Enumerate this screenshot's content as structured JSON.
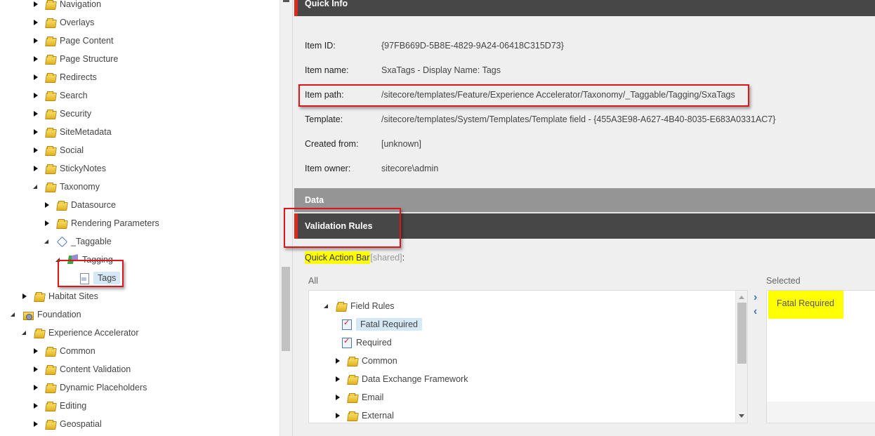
{
  "tree": {
    "nodes": [
      {
        "label": "Navigation",
        "icon": "folder-icon",
        "state": "collapsed"
      },
      {
        "label": "Overlays",
        "icon": "folder-icon",
        "state": "collapsed"
      },
      {
        "label": "Page Content",
        "icon": "folder-icon",
        "state": "collapsed"
      },
      {
        "label": "Page Structure",
        "icon": "folder-icon",
        "state": "collapsed"
      },
      {
        "label": "Redirects",
        "icon": "folder-icon",
        "state": "collapsed"
      },
      {
        "label": "Search",
        "icon": "folder-icon",
        "state": "collapsed"
      },
      {
        "label": "Security",
        "icon": "folder-icon",
        "state": "collapsed"
      },
      {
        "label": "SiteMetadata",
        "icon": "folder-icon",
        "state": "collapsed"
      },
      {
        "label": "Social",
        "icon": "folder-icon",
        "state": "collapsed"
      },
      {
        "label": "StickyNotes",
        "icon": "folder-icon",
        "state": "collapsed"
      },
      {
        "label": "Taxonomy",
        "icon": "folder-icon",
        "state": "expanded"
      },
      {
        "label": "Datasource",
        "icon": "folder-icon",
        "state": "collapsed"
      },
      {
        "label": "Rendering Parameters",
        "icon": "folder-icon",
        "state": "collapsed"
      },
      {
        "label": "_Taggable",
        "icon": "tag-icon",
        "state": "expanded"
      },
      {
        "label": "Tagging",
        "icon": "template-section-icon",
        "state": "expanded"
      },
      {
        "label": "Tags",
        "icon": "template-field-icon",
        "state": "none",
        "selected": true
      },
      {
        "label": "Habitat Sites",
        "icon": "folder-icon",
        "state": "collapsed"
      },
      {
        "label": "Foundation",
        "icon": "settings-folder-icon",
        "state": "expanded"
      },
      {
        "label": "Experience Accelerator",
        "icon": "folder-icon",
        "state": "expanded"
      },
      {
        "label": "Common",
        "icon": "folder-icon",
        "state": "collapsed"
      },
      {
        "label": "Content Validation",
        "icon": "folder-icon",
        "state": "collapsed"
      },
      {
        "label": "Dynamic Placeholders",
        "icon": "folder-icon",
        "state": "collapsed"
      },
      {
        "label": "Editing",
        "icon": "folder-icon",
        "state": "collapsed"
      },
      {
        "label": "Geospatial",
        "icon": "folder-icon",
        "state": "collapsed"
      }
    ]
  },
  "quick_info": {
    "title": "Quick Info",
    "rows": [
      {
        "key": "Item ID:",
        "value": "{97FB669D-5B8E-4829-9A24-06418C315D73}"
      },
      {
        "key": "Item name:",
        "value": "SxaTags - Display Name: Tags"
      },
      {
        "key": "Item path:",
        "value": "/sitecore/templates/Feature/Experience Accelerator/Taxonomy/_Taggable/Tagging/SxaTags"
      },
      {
        "key": "Template:",
        "value": "/sitecore/templates/System/Templates/Template field - {455A3E98-A627-4B40-8035-E683A0331AC7}"
      },
      {
        "key": "Created from:",
        "value": "[unknown]"
      },
      {
        "key": "Item owner:",
        "value": "sitecore\\admin"
      }
    ]
  },
  "sections": {
    "data": "Data",
    "validation_rules": "Validation Rules"
  },
  "field": {
    "label": "Quick Action Bar",
    "shared": "[shared]",
    "colon": ":"
  },
  "all_list": {
    "caption": "All",
    "items": [
      {
        "label": "Field Rules",
        "icon": "folder-icon",
        "state": "expanded"
      },
      {
        "label": "Fatal Required",
        "icon": "validation-rule-icon",
        "state": "none",
        "selected": true
      },
      {
        "label": "Required",
        "icon": "validation-rule-icon",
        "state": "none"
      },
      {
        "label": "Common",
        "icon": "folder-icon",
        "state": "collapsed"
      },
      {
        "label": "Data Exchange Framework",
        "icon": "folder-icon",
        "state": "collapsed"
      },
      {
        "label": "Email",
        "icon": "folder-icon",
        "state": "collapsed"
      },
      {
        "label": "External",
        "icon": "folder-icon",
        "state": "collapsed"
      }
    ]
  },
  "selected_list": {
    "caption": "Selected",
    "items": [
      "Fatal Required"
    ]
  },
  "colors": {
    "accent_red": "#dc291e",
    "highlight_yellow": "#ffff00",
    "selection_blue": "#d5e8f5",
    "section_dark": "#474747",
    "section_gray": "#959595"
  }
}
